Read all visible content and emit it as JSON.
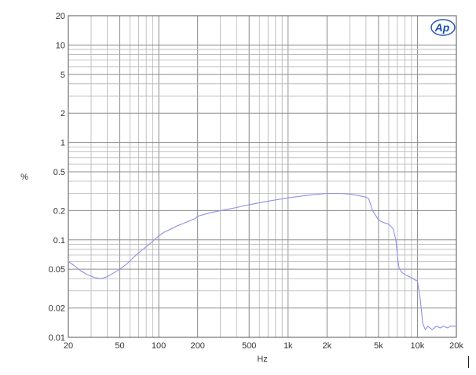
{
  "chart_data": {
    "type": "line",
    "title": "",
    "xlabel": "Hz",
    "ylabel": "%",
    "xscale": "log",
    "yscale": "log",
    "xlim": [
      20,
      20000
    ],
    "ylim": [
      0.01,
      20
    ],
    "grid": true,
    "logo_text": "Ap",
    "colors": {
      "series": "#8f8fe8",
      "logo": "#1a4fb0"
    },
    "x_ticks": [
      {
        "value": 20,
        "label": "20"
      },
      {
        "value": 50,
        "label": "50"
      },
      {
        "value": 100,
        "label": "100"
      },
      {
        "value": 200,
        "label": "200"
      },
      {
        "value": 500,
        "label": "500"
      },
      {
        "value": 1000,
        "label": "1k"
      },
      {
        "value": 2000,
        "label": "2k"
      },
      {
        "value": 5000,
        "label": "5k"
      },
      {
        "value": 10000,
        "label": "10k"
      },
      {
        "value": 20000,
        "label": "20k"
      }
    ],
    "y_ticks": [
      {
        "value": 0.01,
        "label": "0.01"
      },
      {
        "value": 0.02,
        "label": "0.02"
      },
      {
        "value": 0.05,
        "label": "0.05"
      },
      {
        "value": 0.1,
        "label": "0.1"
      },
      {
        "value": 0.2,
        "label": "0.2"
      },
      {
        "value": 0.5,
        "label": "0.5"
      },
      {
        "value": 1,
        "label": "1"
      },
      {
        "value": 2,
        "label": "2"
      },
      {
        "value": 5,
        "label": "5"
      },
      {
        "value": 10,
        "label": "10"
      },
      {
        "value": 20,
        "label": "20"
      }
    ],
    "series": [
      {
        "x": [
          20,
          22,
          25,
          28,
          32,
          36,
          40,
          45,
          50,
          56,
          63,
          70,
          80,
          90,
          100,
          110,
          125,
          140,
          160,
          180,
          190,
          200,
          250,
          300,
          400,
          500,
          700,
          1000,
          1500,
          2000,
          2500,
          3000,
          3500,
          4000,
          4200,
          4500,
          5000,
          5500,
          6000,
          6500,
          6800,
          7000,
          7200,
          7500,
          8000,
          9000,
          9500,
          10000,
          10500,
          11000,
          11500,
          12000,
          13000,
          14000,
          15000,
          16000,
          17000,
          18000,
          19000,
          20000
        ],
        "y": [
          0.06,
          0.055,
          0.048,
          0.044,
          0.041,
          0.04,
          0.042,
          0.046,
          0.05,
          0.056,
          0.065,
          0.074,
          0.085,
          0.097,
          0.11,
          0.12,
          0.13,
          0.14,
          0.15,
          0.16,
          0.165,
          0.175,
          0.19,
          0.2,
          0.215,
          0.23,
          0.25,
          0.27,
          0.29,
          0.3,
          0.3,
          0.295,
          0.285,
          0.275,
          0.265,
          0.2,
          0.16,
          0.15,
          0.145,
          0.13,
          0.1,
          0.07,
          0.052,
          0.047,
          0.044,
          0.041,
          0.039,
          0.038,
          0.025,
          0.014,
          0.012,
          0.013,
          0.012,
          0.013,
          0.0125,
          0.013,
          0.0125,
          0.013,
          0.013,
          0.013
        ]
      }
    ]
  }
}
